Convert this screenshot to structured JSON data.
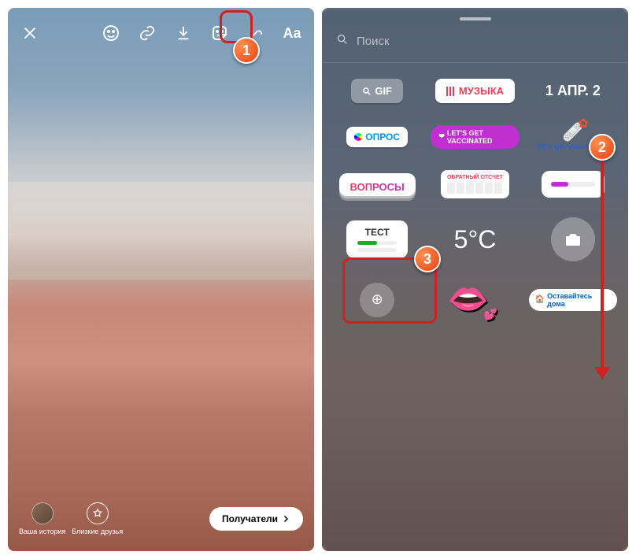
{
  "callouts": {
    "one": "1",
    "two": "2",
    "three": "3"
  },
  "left": {
    "toolbar_text": "Aa",
    "bottom": {
      "your_story": "Ваша история",
      "close_friends": "Близкие друзья",
      "recipients": "Получатели"
    }
  },
  "right": {
    "search_placeholder": "Поиск",
    "stickers": {
      "gif": "GIF",
      "music": "МУЗЫКА",
      "date": "1 АПР. 2",
      "poll": "ОПРОС",
      "vaccinated": "LET'S GET VACCINATED",
      "vaccinated_alt": "let's get vaccinated",
      "questions": "ВОПРОСЫ",
      "countdown": "ОБРАТНЫЙ ОТСЧЕТ",
      "quiz": "ТЕСТ",
      "temperature": "5°C",
      "stay_home": "Оставайтесь дома"
    }
  }
}
